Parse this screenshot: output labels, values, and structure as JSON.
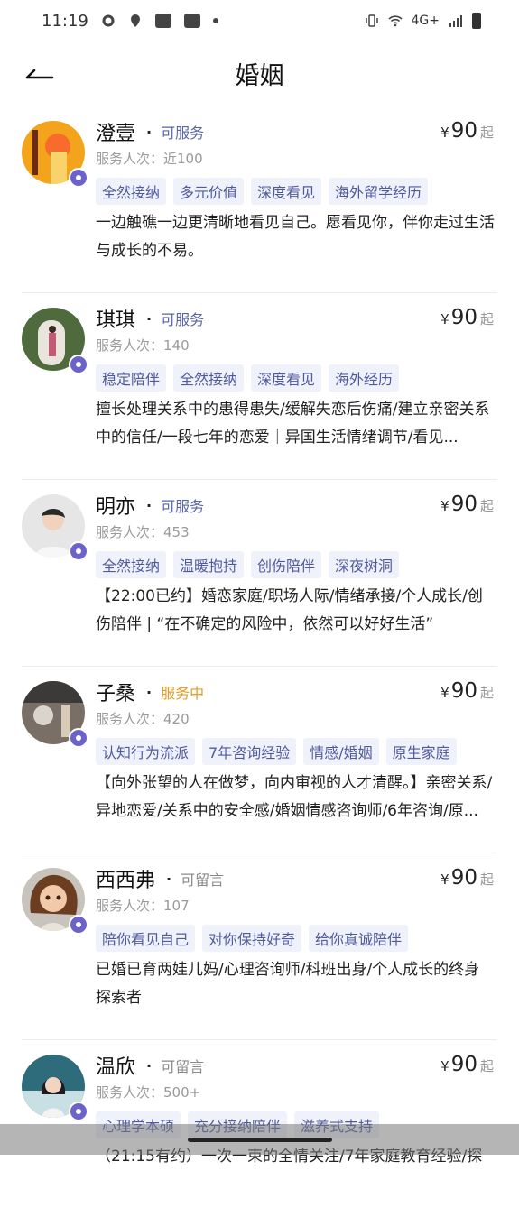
{
  "status_bar": {
    "time": "11:19",
    "network": "4G+"
  },
  "header": {
    "title": "婚姻"
  },
  "counselors": [
    {
      "name": "澄壹",
      "status": "可服务",
      "status_type": "available",
      "price_symbol": "¥",
      "price": "90",
      "price_suffix": "起",
      "count": "服务人次：近100",
      "tags": [
        "全然接纳",
        "多元价值",
        "深度看见",
        "海外留学经历"
      ],
      "desc": "一边触礁一边更清晰地看见自己。愿看见你，伴你走过生活与成长的不易。"
    },
    {
      "name": "琪琪",
      "status": "可服务",
      "status_type": "available",
      "price_symbol": "¥",
      "price": "90",
      "price_suffix": "起",
      "count": "服务人次：140",
      "tags": [
        "稳定陪伴",
        "全然接纳",
        "深度看见",
        "海外经历"
      ],
      "desc": "擅长处理关系中的患得患失/缓解失恋后伤痛/建立亲密关系中的信任/一段七年的恋爱｜异国生活情绪调节/看见..."
    },
    {
      "name": "明亦",
      "status": "可服务",
      "status_type": "available",
      "price_symbol": "¥",
      "price": "90",
      "price_suffix": "起",
      "count": "服务人次：453",
      "tags": [
        "全然接纳",
        "温暖抱持",
        "创伤陪伴",
        "深夜树洞"
      ],
      "desc": "【22:00已约】婚恋家庭/职场人际/情绪承接/个人成长/创伤陪伴 | “在不确定的风险中，依然可以好好生活”"
    },
    {
      "name": "子桑",
      "status": "服务中",
      "status_type": "busy",
      "price_symbol": "¥",
      "price": "90",
      "price_suffix": "起",
      "count": "服务人次：420",
      "tags": [
        "认知行为流派",
        "7年咨询经验",
        "情感/婚姻",
        "原生家庭"
      ],
      "desc": "【向外张望的人在做梦，向内审视的人才清醒。】亲密关系/异地恋爱/关系中的安全感/婚姻情感咨询师/6年咨询/原..."
    },
    {
      "name": "西西弗",
      "status": "可留言",
      "status_type": "message",
      "price_symbol": "¥",
      "price": "90",
      "price_suffix": "起",
      "count": "服务人次：107",
      "tags": [
        "陪你看见自己",
        "对你保持好奇",
        "给你真诚陪伴"
      ],
      "desc": "已婚已育两娃儿妈/心理咨询师/科班出身/个人成长的终身探索者"
    },
    {
      "name": "温欣",
      "status": "可留言",
      "status_type": "message",
      "price_symbol": "¥",
      "price": "90",
      "price_suffix": "起",
      "count": "服务人次：500+",
      "tags": [
        "心理学本硕",
        "充分接纳陪伴",
        "滋养式支持"
      ],
      "desc": "（21:15有约）一次一束的全情关注/7年家庭教育经验/探"
    }
  ],
  "colors": {
    "accent": "#5a64a8",
    "busy": "#e39b24",
    "tag_bg": "#f0f2fb",
    "badge": "#6b63c9"
  }
}
